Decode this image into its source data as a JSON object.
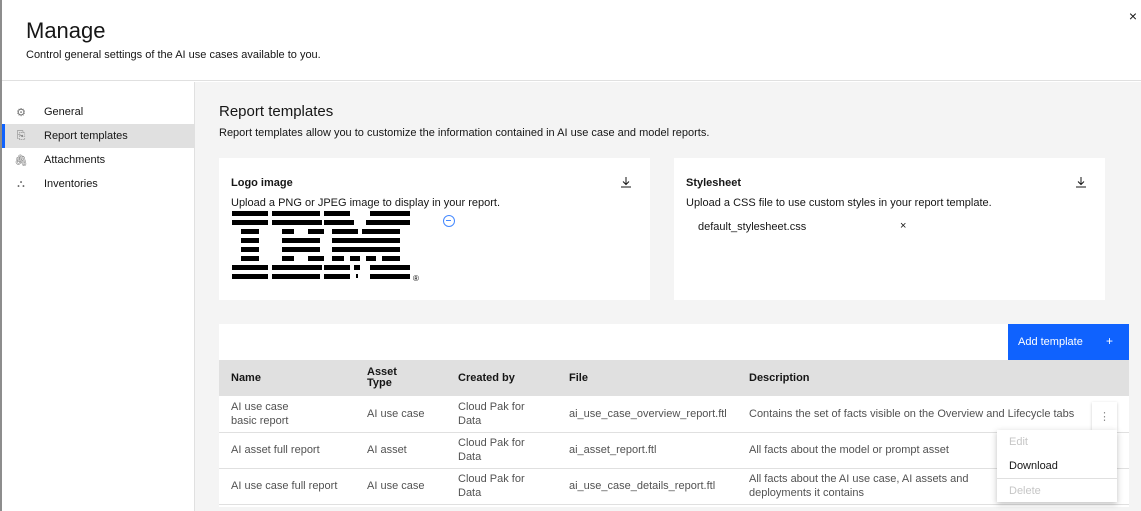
{
  "header": {
    "title": "Manage",
    "subtitle": "Control general settings of the AI use cases available to you.",
    "close_icon": "×"
  },
  "sidebar": {
    "items": [
      {
        "label": "General",
        "icon": "⚙"
      },
      {
        "label": "Report templates",
        "icon": "⎘"
      },
      {
        "label": "Attachments",
        "icon": "🖇"
      },
      {
        "label": "Inventories",
        "icon": "⛬"
      }
    ],
    "active": "Report templates"
  },
  "main": {
    "title": "Report templates",
    "description": "Report templates allow you to customize the information contained in AI use case and model reports.",
    "logo_tile": {
      "title": "Logo image",
      "description": "Upload a PNG or JPEG image to display in your report.",
      "logo_text": "IBM",
      "registered": "®"
    },
    "stylesheet_tile": {
      "title": "Stylesheet",
      "description": "Upload a CSS file to use custom styles in your report template.",
      "file_name": "default_stylesheet.css",
      "remove_icon": "×"
    },
    "add_button": {
      "label": "Add template",
      "icon": "+"
    },
    "table": {
      "headers": [
        "Name",
        "Asset Type",
        "Created by",
        "File",
        "Description"
      ],
      "rows": [
        [
          "AI use case basic report",
          "AI use case",
          "Cloud Pak for Data",
          "ai_use_case_overview_report.ftl",
          "Contains the set of facts visible on the Overview and Lifecycle tabs"
        ],
        [
          "AI asset full report",
          "AI asset",
          "Cloud Pak for Data",
          "ai_asset_report.ftl",
          "All facts about the model or prompt asset"
        ],
        [
          "AI use case full report",
          "AI use case",
          "Cloud Pak for Data",
          "ai_use_case_details_report.ftl",
          "All facts about the AI use case, AI assets and deployments it contains"
        ]
      ]
    },
    "overflow_menu": {
      "icon": "⋮",
      "items": [
        {
          "label": "Edit",
          "disabled": true
        },
        {
          "label": "Download",
          "disabled": false
        },
        {
          "label": "Delete",
          "disabled": true
        }
      ]
    }
  },
  "colors": {
    "accent": "#0f62fe",
    "page_bg": "#f4f4f4",
    "header_row": "#e0e0e0"
  }
}
